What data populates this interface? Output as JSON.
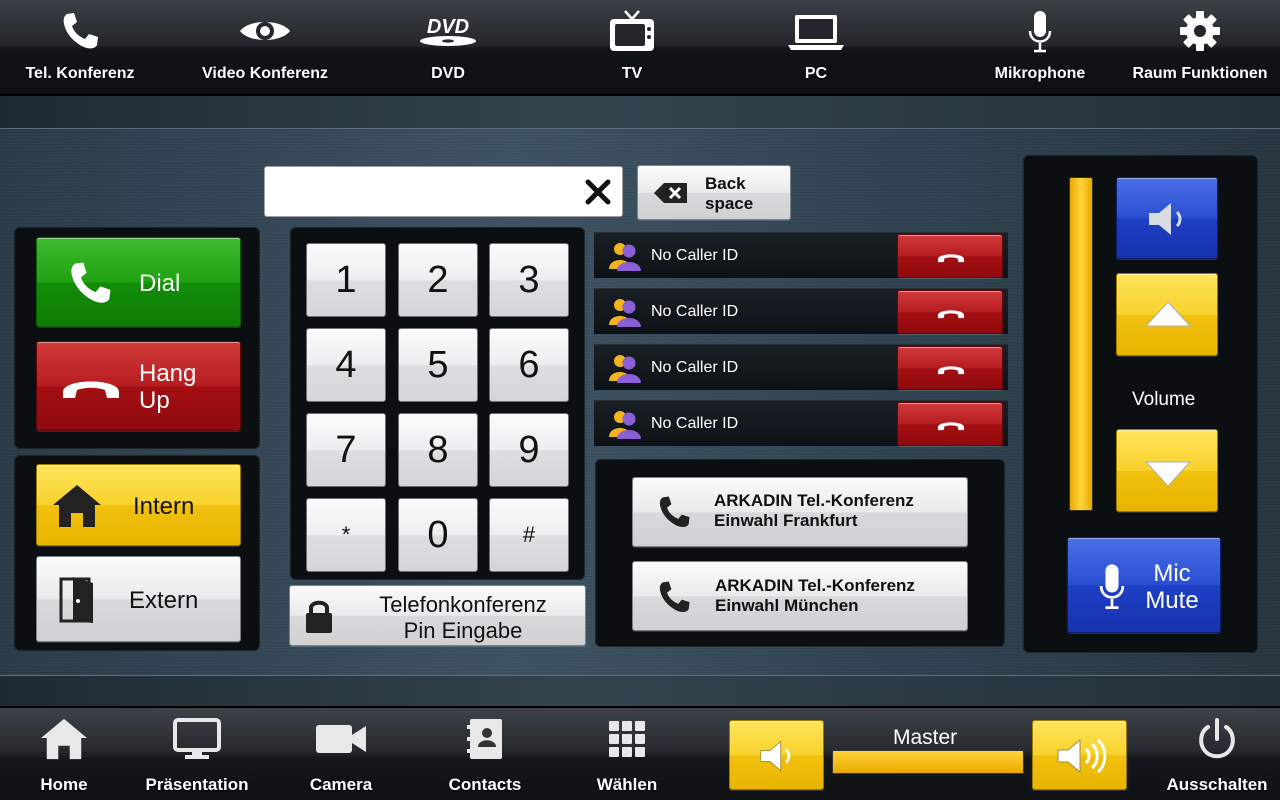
{
  "top_nav": [
    {
      "label": "Tel. Konferenz",
      "icon": "phone-icon"
    },
    {
      "label": "Video Konferenz",
      "icon": "eye-icon"
    },
    {
      "label": "DVD",
      "icon": "dvd-icon"
    },
    {
      "label": "TV",
      "icon": "tv-icon"
    },
    {
      "label": "PC",
      "icon": "laptop-icon"
    },
    {
      "label": "Mikrophone",
      "icon": "microphone-icon"
    },
    {
      "label": "Raum Funktionen",
      "icon": "gear-icon"
    }
  ],
  "dialer": {
    "number_value": "",
    "clear_symbol": "✕",
    "backspace_label_line1": "Back",
    "backspace_label_line2": "space",
    "dial_label": "Dial",
    "hangup_label_line1": "Hang",
    "hangup_label_line2": "Up",
    "intern_label": "Intern",
    "extern_label": "Extern",
    "keys": [
      "1",
      "2",
      "3",
      "4",
      "5",
      "6",
      "7",
      "8",
      "9",
      "*",
      "0",
      "#"
    ],
    "pin_label_line1": "Telefonkonferenz",
    "pin_label_line2": "Pin Eingabe"
  },
  "callers": [
    {
      "caller_id": "No Caller ID"
    },
    {
      "caller_id": "No Caller ID"
    },
    {
      "caller_id": "No Caller ID"
    },
    {
      "caller_id": "No Caller ID"
    }
  ],
  "quick_dials": [
    {
      "line1": "ARKADIN Tel.-Konferenz",
      "line2": "Einwahl Frankfurt"
    },
    {
      "line1": "ARKADIN Tel.-Konferenz",
      "line2": "Einwahl München"
    }
  ],
  "volume": {
    "label": "Volume",
    "level": 1.0,
    "mic_mute_line1": "Mic",
    "mic_mute_line2": "Mute"
  },
  "bottom_nav": [
    {
      "label": "Home",
      "icon": "home-icon"
    },
    {
      "label": "Präsentation",
      "icon": "monitor-icon"
    },
    {
      "label": "Camera",
      "icon": "camera-icon"
    },
    {
      "label": "Contacts",
      "icon": "contacts-icon"
    },
    {
      "label": "Wählen",
      "icon": "keypad-icon"
    },
    {
      "label": "Ausschalten",
      "icon": "power-icon"
    }
  ],
  "master": {
    "label": "Master",
    "level": 1.0
  },
  "colors": {
    "accent_yellow": "#f8d22c",
    "accent_blue": "#2a4ed2",
    "dial_green": "#21a213",
    "hangup_red": "#b71c20"
  }
}
